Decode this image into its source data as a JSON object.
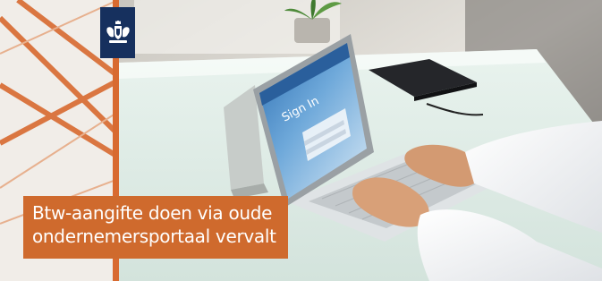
{
  "banner": {
    "caption_line1": "Btw-aangifte doen via oude",
    "caption_line2": "ondernemersportaal vervalt",
    "screen_heading": "Sign In"
  },
  "colors": {
    "accent_orange": "#cf6a2d",
    "logo_blue": "#16305e",
    "background": "#ffffff"
  },
  "icons": [
    "coat-of-arms-icon"
  ]
}
